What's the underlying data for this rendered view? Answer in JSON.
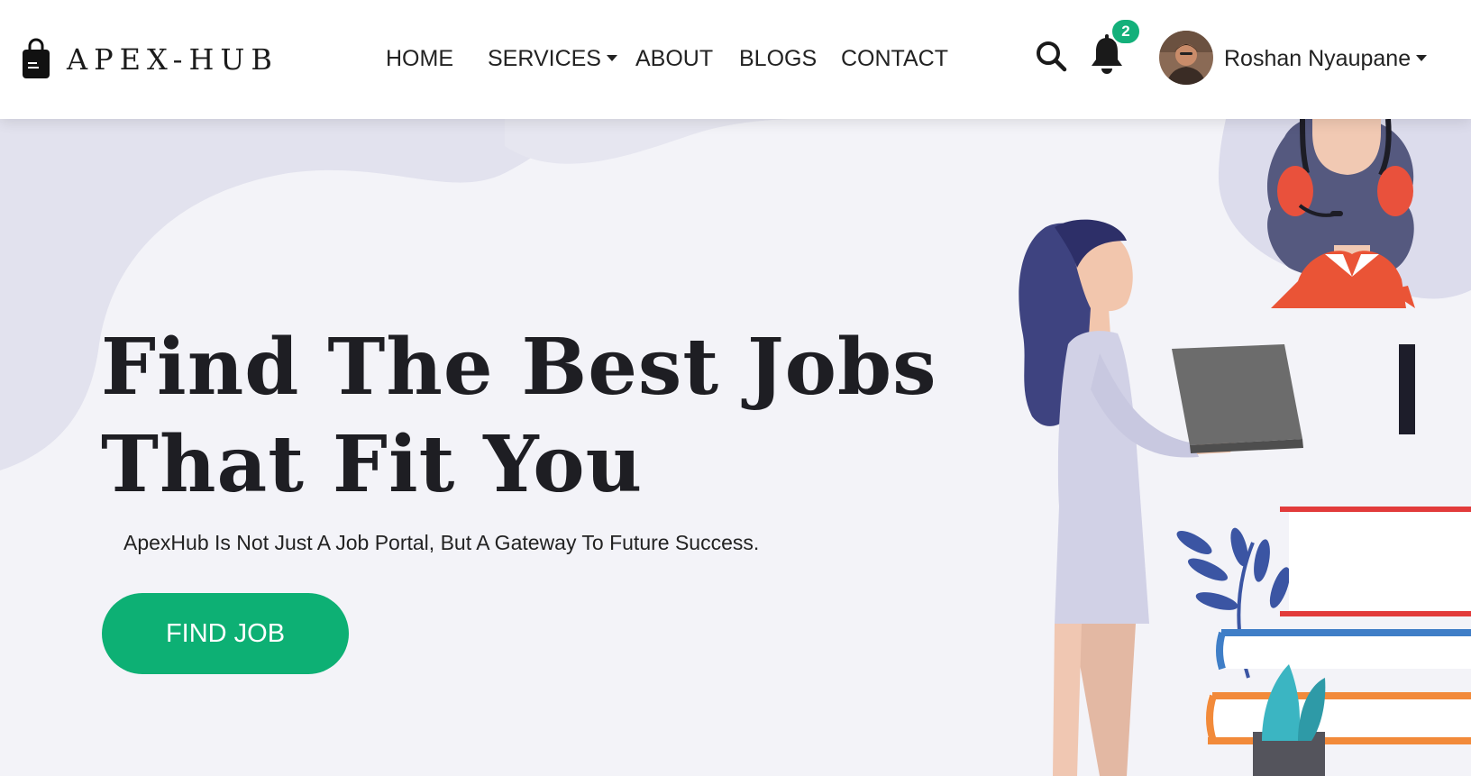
{
  "brand": {
    "name": "APEX-HUB",
    "icon": "shopping-bag-icon"
  },
  "nav": {
    "items": [
      {
        "label": "HOME"
      },
      {
        "label": "SERVICES",
        "has_dropdown": true
      },
      {
        "label": "ABOUT"
      },
      {
        "label": "BLOGS"
      },
      {
        "label": "CONTACT"
      }
    ]
  },
  "header_actions": {
    "search_icon": "search-icon",
    "bell_icon": "bell-icon",
    "notification_count": "2",
    "user": {
      "name": "Roshan Nyaupane",
      "has_dropdown": true
    }
  },
  "hero": {
    "title_line1": "Find The Best Jobs",
    "title_line2": "That Fit You",
    "subtitle": "ApexHub Is Not Just A Job Portal, But A Gateway To Future Success.",
    "cta_label": "FIND JOB"
  },
  "colors": {
    "accent": "#0db074",
    "badge": "#13b07a",
    "text_dark": "#1e1e23",
    "hero_bg": "#f2f2f7"
  }
}
